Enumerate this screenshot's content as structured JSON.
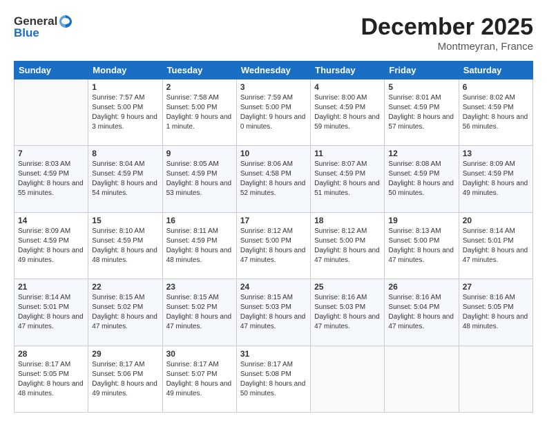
{
  "header": {
    "logo_general": "General",
    "logo_blue": "Blue",
    "month": "December 2025",
    "location": "Montmeyran, France"
  },
  "days_of_week": [
    "Sunday",
    "Monday",
    "Tuesday",
    "Wednesday",
    "Thursday",
    "Friday",
    "Saturday"
  ],
  "weeks": [
    [
      {
        "day": "",
        "sunrise": "",
        "sunset": "",
        "daylight": ""
      },
      {
        "day": "1",
        "sunrise": "Sunrise: 7:57 AM",
        "sunset": "Sunset: 5:00 PM",
        "daylight": "Daylight: 9 hours and 3 minutes."
      },
      {
        "day": "2",
        "sunrise": "Sunrise: 7:58 AM",
        "sunset": "Sunset: 5:00 PM",
        "daylight": "Daylight: 9 hours and 1 minute."
      },
      {
        "day": "3",
        "sunrise": "Sunrise: 7:59 AM",
        "sunset": "Sunset: 5:00 PM",
        "daylight": "Daylight: 9 hours and 0 minutes."
      },
      {
        "day": "4",
        "sunrise": "Sunrise: 8:00 AM",
        "sunset": "Sunset: 4:59 PM",
        "daylight": "Daylight: 8 hours and 59 minutes."
      },
      {
        "day": "5",
        "sunrise": "Sunrise: 8:01 AM",
        "sunset": "Sunset: 4:59 PM",
        "daylight": "Daylight: 8 hours and 57 minutes."
      },
      {
        "day": "6",
        "sunrise": "Sunrise: 8:02 AM",
        "sunset": "Sunset: 4:59 PM",
        "daylight": "Daylight: 8 hours and 56 minutes."
      }
    ],
    [
      {
        "day": "7",
        "sunrise": "Sunrise: 8:03 AM",
        "sunset": "Sunset: 4:59 PM",
        "daylight": "Daylight: 8 hours and 55 minutes."
      },
      {
        "day": "8",
        "sunrise": "Sunrise: 8:04 AM",
        "sunset": "Sunset: 4:59 PM",
        "daylight": "Daylight: 8 hours and 54 minutes."
      },
      {
        "day": "9",
        "sunrise": "Sunrise: 8:05 AM",
        "sunset": "Sunset: 4:59 PM",
        "daylight": "Daylight: 8 hours and 53 minutes."
      },
      {
        "day": "10",
        "sunrise": "Sunrise: 8:06 AM",
        "sunset": "Sunset: 4:58 PM",
        "daylight": "Daylight: 8 hours and 52 minutes."
      },
      {
        "day": "11",
        "sunrise": "Sunrise: 8:07 AM",
        "sunset": "Sunset: 4:59 PM",
        "daylight": "Daylight: 8 hours and 51 minutes."
      },
      {
        "day": "12",
        "sunrise": "Sunrise: 8:08 AM",
        "sunset": "Sunset: 4:59 PM",
        "daylight": "Daylight: 8 hours and 50 minutes."
      },
      {
        "day": "13",
        "sunrise": "Sunrise: 8:09 AM",
        "sunset": "Sunset: 4:59 PM",
        "daylight": "Daylight: 8 hours and 49 minutes."
      }
    ],
    [
      {
        "day": "14",
        "sunrise": "Sunrise: 8:09 AM",
        "sunset": "Sunset: 4:59 PM",
        "daylight": "Daylight: 8 hours and 49 minutes."
      },
      {
        "day": "15",
        "sunrise": "Sunrise: 8:10 AM",
        "sunset": "Sunset: 4:59 PM",
        "daylight": "Daylight: 8 hours and 48 minutes."
      },
      {
        "day": "16",
        "sunrise": "Sunrise: 8:11 AM",
        "sunset": "Sunset: 4:59 PM",
        "daylight": "Daylight: 8 hours and 48 minutes."
      },
      {
        "day": "17",
        "sunrise": "Sunrise: 8:12 AM",
        "sunset": "Sunset: 5:00 PM",
        "daylight": "Daylight: 8 hours and 47 minutes."
      },
      {
        "day": "18",
        "sunrise": "Sunrise: 8:12 AM",
        "sunset": "Sunset: 5:00 PM",
        "daylight": "Daylight: 8 hours and 47 minutes."
      },
      {
        "day": "19",
        "sunrise": "Sunrise: 8:13 AM",
        "sunset": "Sunset: 5:00 PM",
        "daylight": "Daylight: 8 hours and 47 minutes."
      },
      {
        "day": "20",
        "sunrise": "Sunrise: 8:14 AM",
        "sunset": "Sunset: 5:01 PM",
        "daylight": "Daylight: 8 hours and 47 minutes."
      }
    ],
    [
      {
        "day": "21",
        "sunrise": "Sunrise: 8:14 AM",
        "sunset": "Sunset: 5:01 PM",
        "daylight": "Daylight: 8 hours and 47 minutes."
      },
      {
        "day": "22",
        "sunrise": "Sunrise: 8:15 AM",
        "sunset": "Sunset: 5:02 PM",
        "daylight": "Daylight: 8 hours and 47 minutes."
      },
      {
        "day": "23",
        "sunrise": "Sunrise: 8:15 AM",
        "sunset": "Sunset: 5:02 PM",
        "daylight": "Daylight: 8 hours and 47 minutes."
      },
      {
        "day": "24",
        "sunrise": "Sunrise: 8:15 AM",
        "sunset": "Sunset: 5:03 PM",
        "daylight": "Daylight: 8 hours and 47 minutes."
      },
      {
        "day": "25",
        "sunrise": "Sunrise: 8:16 AM",
        "sunset": "Sunset: 5:03 PM",
        "daylight": "Daylight: 8 hours and 47 minutes."
      },
      {
        "day": "26",
        "sunrise": "Sunrise: 8:16 AM",
        "sunset": "Sunset: 5:04 PM",
        "daylight": "Daylight: 8 hours and 47 minutes."
      },
      {
        "day": "27",
        "sunrise": "Sunrise: 8:16 AM",
        "sunset": "Sunset: 5:05 PM",
        "daylight": "Daylight: 8 hours and 48 minutes."
      }
    ],
    [
      {
        "day": "28",
        "sunrise": "Sunrise: 8:17 AM",
        "sunset": "Sunset: 5:05 PM",
        "daylight": "Daylight: 8 hours and 48 minutes."
      },
      {
        "day": "29",
        "sunrise": "Sunrise: 8:17 AM",
        "sunset": "Sunset: 5:06 PM",
        "daylight": "Daylight: 8 hours and 49 minutes."
      },
      {
        "day": "30",
        "sunrise": "Sunrise: 8:17 AM",
        "sunset": "Sunset: 5:07 PM",
        "daylight": "Daylight: 8 hours and 49 minutes."
      },
      {
        "day": "31",
        "sunrise": "Sunrise: 8:17 AM",
        "sunset": "Sunset: 5:08 PM",
        "daylight": "Daylight: 8 hours and 50 minutes."
      },
      {
        "day": "",
        "sunrise": "",
        "sunset": "",
        "daylight": ""
      },
      {
        "day": "",
        "sunrise": "",
        "sunset": "",
        "daylight": ""
      },
      {
        "day": "",
        "sunrise": "",
        "sunset": "",
        "daylight": ""
      }
    ]
  ]
}
